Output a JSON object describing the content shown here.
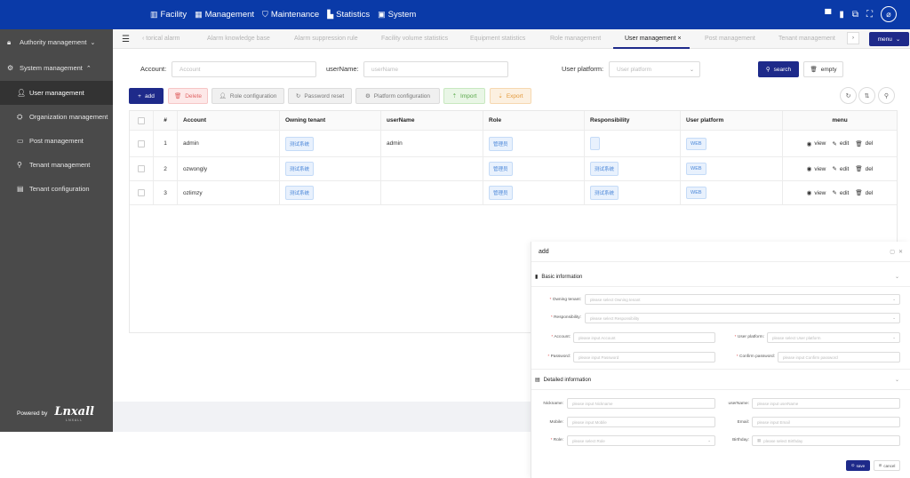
{
  "topnav": [
    {
      "icon": "facility-icon",
      "glyph": "▥",
      "label": "Facility"
    },
    {
      "icon": "management-icon",
      "glyph": "▦",
      "label": "Management"
    },
    {
      "icon": "maintenance-icon",
      "glyph": "⛉",
      "label": "Maintenance"
    },
    {
      "icon": "statistics-icon",
      "glyph": "▙",
      "label": "Statistics"
    },
    {
      "icon": "system-icon",
      "glyph": "▣",
      "label": "System"
    }
  ],
  "sidebar": {
    "groups": [
      {
        "label": "Authority management",
        "icon": "lock-icon"
      },
      {
        "label": "System management",
        "icon": "gear-icon"
      }
    ],
    "items": [
      {
        "label": "User management",
        "icon": "user-icon",
        "active": true
      },
      {
        "label": "Organization management",
        "icon": "organization-icon"
      },
      {
        "label": "Post management",
        "icon": "post-icon"
      },
      {
        "label": "Tenant management",
        "icon": "key-icon"
      },
      {
        "label": "Tenant configuration",
        "icon": "document-icon"
      }
    ],
    "powered_by": "Powered by",
    "logo_text": "Lnxall",
    "logo_sub": "LNXALL"
  },
  "tabs": {
    "items": [
      {
        "label": "‹  torical alarm"
      },
      {
        "label": "Alarm knowledge base"
      },
      {
        "label": "Alarm suppression rule"
      },
      {
        "label": "Facility volume statistics"
      },
      {
        "label": "Equipment statistics"
      },
      {
        "label": "Role management"
      },
      {
        "label": "User management  ×"
      },
      {
        "label": "Post management"
      },
      {
        "label": "Tenant management"
      }
    ],
    "right_arrow": "›",
    "menu_label": "menu"
  },
  "filters": {
    "account_label": "Account:",
    "account_placeholder": "Account",
    "username_label": "userName:",
    "username_placeholder": "userName",
    "platform_label": "User platform:",
    "platform_placeholder": "User platform",
    "search_label": "search",
    "empty_label": "empty"
  },
  "toolbar": {
    "add": "add",
    "delete": "Delete",
    "role_config": "Role configuration",
    "password_reset": "Password reset",
    "platform_config": "Platform configuration",
    "import": "Import",
    "export": "Export"
  },
  "table": {
    "headers": [
      "#",
      "Account",
      "Owning tenant",
      "userName",
      "Role",
      "Responsibility",
      "User platform",
      "menu"
    ],
    "rows": [
      {
        "num": "1",
        "account": "admin",
        "tenant": "测试系统",
        "username": "admin",
        "role": "管理员",
        "responsibility": "",
        "platform": "WEB"
      },
      {
        "num": "2",
        "account": "ozwongly",
        "tenant": "测试系统",
        "username": "",
        "role": "管理员",
        "responsibility": "测试系统",
        "platform": "WEB"
      },
      {
        "num": "3",
        "account": "ozlimzy",
        "tenant": "测试系统",
        "username": "",
        "role": "管理员",
        "responsibility": "测试系统",
        "platform": "WEB"
      }
    ],
    "ops": {
      "view": "view",
      "edit": "edit",
      "del": "del"
    }
  },
  "dialog": {
    "title": "add",
    "basic_section": "Basic information",
    "detail_section": "Detailed information",
    "fields": {
      "owning_tenant_label": "Owning tenant:",
      "owning_tenant_ph": "please select Owning tenant",
      "responsibility_label": "Responsibility:",
      "responsibility_ph": "please select Responsibility",
      "account_label": "Account:",
      "account_ph": "please input Account",
      "user_platform_label": "User platform:",
      "user_platform_ph": "please select User platform",
      "password_label": "Password:",
      "password_ph": "please input Password",
      "confirm_label": "Confirm password:",
      "confirm_ph": "please input Confirm password",
      "nickname_label": "Nickname:",
      "nickname_ph": "please input Nickname",
      "username_label": "userName:",
      "username_ph": "please input userName",
      "mobile_label": "Mobile:",
      "mobile_ph": "please input Mobile",
      "email_label": "Email:",
      "email_ph": "please input Email",
      "role_label": "Role:",
      "role_ph": "please select Role",
      "birthday_label": "Birthday:",
      "birthday_ph": "please select Birthday"
    },
    "save": "save",
    "cancel": "cancel"
  },
  "colors": {
    "brand": "#0a3aa8",
    "primary": "#1e2a8a",
    "sidebar": "#4a4a4a"
  }
}
